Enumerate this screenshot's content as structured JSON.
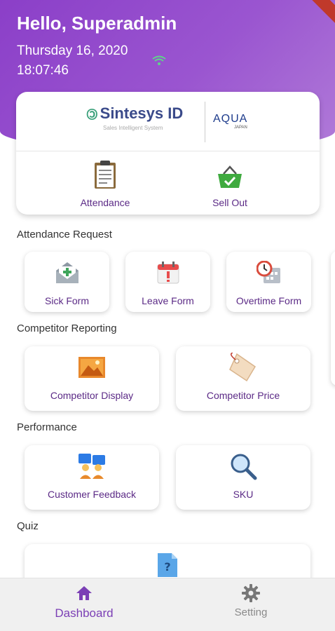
{
  "header": {
    "greeting": "Hello, Superadmin",
    "date": "Thursday 16, 2020",
    "time": "18:07:46",
    "accent_color": "#8b3fc8"
  },
  "brand": {
    "sintesys_name": "Sintesys ID",
    "sintesys_tagline": "Sales Intelligent System",
    "aqua_name": "AQUA",
    "aqua_sub": "JAPAN"
  },
  "quick_actions": [
    {
      "label": "Attendance",
      "icon": "clipboard-icon"
    },
    {
      "label": "Sell Out",
      "icon": "basket-check-icon"
    }
  ],
  "sections": {
    "attendance_request": {
      "title": "Attendance Request",
      "items": [
        {
          "label": "Sick Form",
          "icon": "medical-envelope-icon"
        },
        {
          "label": "Leave Form",
          "icon": "calendar-alert-icon"
        },
        {
          "label": "Overtime Form",
          "icon": "clock-calendar-icon"
        }
      ]
    },
    "competitor_reporting": {
      "title": "Competitor Reporting",
      "items": [
        {
          "label": "Competitor Display",
          "icon": "image-frame-icon"
        },
        {
          "label": "Competitor Price",
          "icon": "price-tag-icon"
        }
      ]
    },
    "performance": {
      "title": "Performance",
      "items": [
        {
          "label": "Customer Feedback",
          "icon": "people-icon"
        },
        {
          "label": "SKU",
          "icon": "magnifier-icon"
        }
      ]
    },
    "quiz": {
      "title": "Quiz",
      "items": [
        {
          "label": "",
          "icon": "question-document-icon"
        }
      ]
    }
  },
  "bottom_nav": [
    {
      "label": "Dashboard",
      "icon": "home-icon",
      "active": true
    },
    {
      "label": "Setting",
      "icon": "gear-icon",
      "active": false
    }
  ]
}
